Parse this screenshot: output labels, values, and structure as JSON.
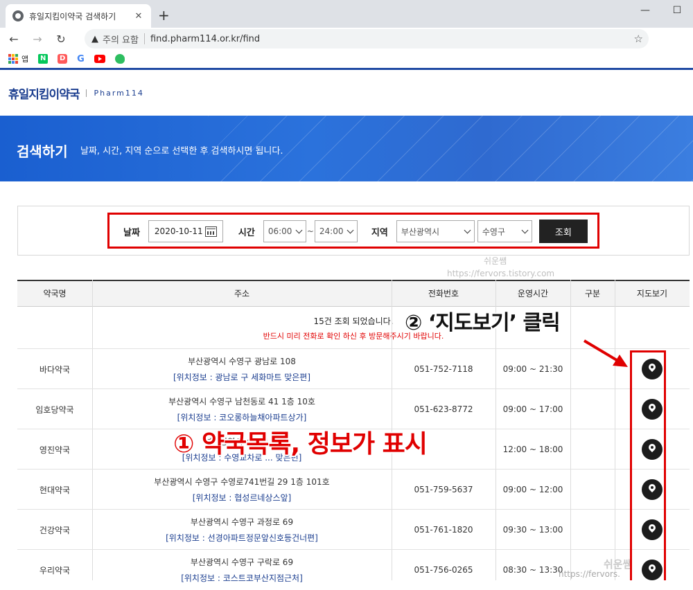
{
  "browser": {
    "tab_title": "휴일지킴이약국 검색하기",
    "warning_text": "주의 요함",
    "url": "find.pharm114.or.kr/find",
    "bookmarks": [
      "앱",
      "N",
      "D",
      "G",
      "",
      ""
    ]
  },
  "site": {
    "logo_main": "휴일지킴이약국",
    "logo_sub": "Pharm114"
  },
  "banner": {
    "title": "검색하기",
    "description": "날짜, 시간, 지역 순으로 선택한 후 검색하시면 됩니다."
  },
  "search": {
    "date_label": "날짜",
    "date_value": "2020-10-11",
    "time_label": "시간",
    "time_from": "06:00",
    "time_sep": "~",
    "time_to": "24:00",
    "region_label": "지역",
    "city": "부산광역시",
    "district": "수영구",
    "submit_label": "조회"
  },
  "watermark": {
    "name": "쉬운쌤",
    "url": "https://fervors.tistory.com",
    "url_short": "https://fervors."
  },
  "table": {
    "headers": [
      "약국명",
      "주소",
      "전화번호",
      "운영시간",
      "구분",
      "지도보기"
    ],
    "count_text": "15건 조회 되었습니다.",
    "note_text": "반드시 미리 전화로 확인 하신 후 방문해주시기 바랍니다.",
    "rows": [
      {
        "name": "바다약국",
        "address": "부산광역시 수영구 광남로 108",
        "location": "[위치정보 : 광남로 구 세화마트 맞은편]",
        "phone": "051-752-7118",
        "hours": "09:00 ~ 21:30",
        "type": ""
      },
      {
        "name": "임호당약국",
        "address": "부산광역시 수영구 남천동로 41 1층 10호",
        "location": "[위치정보 : 코오롱하늘채아파트상가]",
        "phone": "051-623-8772",
        "hours": "09:00 ~ 17:00",
        "type": ""
      },
      {
        "name": "영진약국",
        "address": "부산광역시 수영구 ...",
        "location": "[위치정보 : 수영교차로 ... 맞은편]",
        "phone": "",
        "hours": "12:00 ~ 18:00",
        "type": ""
      },
      {
        "name": "현대약국",
        "address": "부산광역시 수영구 수영로741번길 29 1층 101호",
        "location": "[위치정보 : 협성르네상스앞]",
        "phone": "051-759-5637",
        "hours": "09:00 ~ 12:00",
        "type": ""
      },
      {
        "name": "건강약국",
        "address": "부산광역시 수영구 과정로 69",
        "location": "[위치정보 : 선경아파트정문앞신호등건너편]",
        "phone": "051-761-1820",
        "hours": "09:30 ~ 13:00",
        "type": ""
      },
      {
        "name": "우리약국",
        "address": "부산광역시 수영구 구락로 69",
        "location": "[위치정보 : 코스트코부산지점근처]",
        "phone": "051-756-0265",
        "hours": "08:30 ~ 13:30",
        "type": ""
      }
    ]
  },
  "annotations": {
    "step1": "① 약국목록, 정보가 표시",
    "step2": "② ‘지도보기’ 클릭"
  },
  "colors": {
    "brand": "#1a3d8f",
    "banner": "#2b72dc",
    "highlight": "#e00000",
    "notice": "#e10000"
  }
}
